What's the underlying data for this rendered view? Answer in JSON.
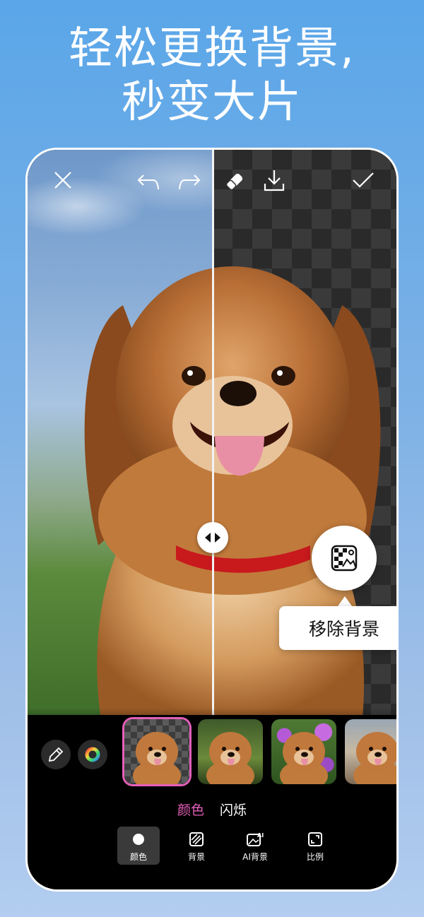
{
  "headline": {
    "line1": "轻松更换背景,",
    "line2": "秒变大片"
  },
  "topbar": {
    "icons": [
      "close-icon",
      "undo-icon",
      "redo-icon",
      "eraser-icon",
      "download-icon",
      "check-icon"
    ]
  },
  "tooltip": {
    "label": "移除背景"
  },
  "tabs": {
    "active": "颜色",
    "inactive": "闪烁"
  },
  "toolbar": {
    "items": [
      {
        "label": "颜色",
        "icon": "circle-icon"
      },
      {
        "label": "背景",
        "icon": "pattern-icon"
      },
      {
        "label": "AI背景",
        "icon": "ai-image-icon"
      },
      {
        "label": "比例",
        "icon": "aspect-ratio-icon"
      }
    ]
  },
  "colors": {
    "accent": "#e45fb8",
    "background": "#5aa6e8",
    "panel": "#000000"
  }
}
